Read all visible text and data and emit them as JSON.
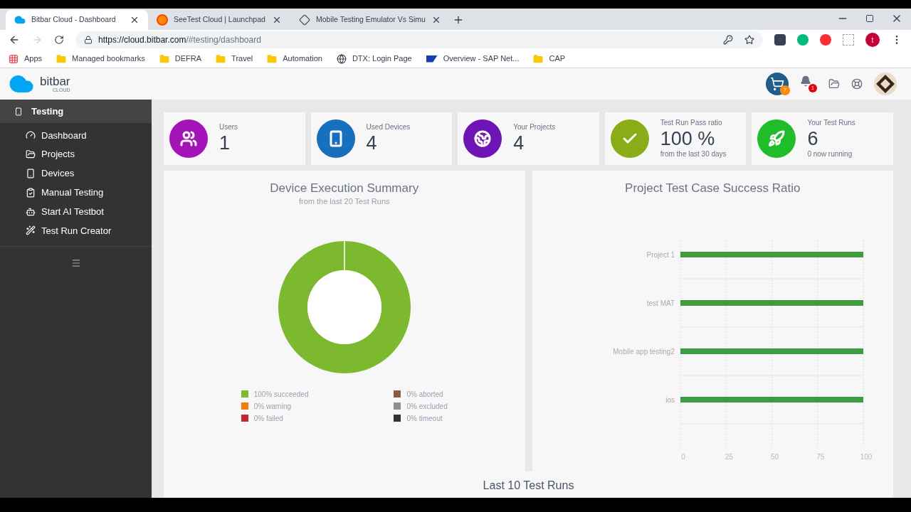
{
  "browser": {
    "tabs": [
      {
        "title": "Bitbar Cloud - Dashboard",
        "kind": "cloud",
        "selected": true
      },
      {
        "title": "SeeTest Cloud | Launchpad",
        "kind": "seetest",
        "selected": false
      },
      {
        "title": "Mobile Testing Emulator Vs Simu",
        "kind": "diamond",
        "selected": false
      }
    ],
    "url_host": "https://cloud.bitbar.com",
    "url_path": "/#testing/dashboard",
    "profile_initial": "t",
    "bookmarks": [
      {
        "label": "Apps",
        "kind": "apps"
      },
      {
        "label": "Managed bookmarks",
        "kind": "folder"
      },
      {
        "label": "DEFRA",
        "kind": "folder"
      },
      {
        "label": "Travel",
        "kind": "folder"
      },
      {
        "label": "Automation",
        "kind": "folder"
      },
      {
        "label": "DTX: Login Page",
        "kind": "globe"
      },
      {
        "label": "Overview - SAP Net...",
        "kind": "sap"
      },
      {
        "label": "CAP",
        "kind": "folder"
      }
    ]
  },
  "header": {
    "logo": "bitbar",
    "logo_sub": "CLOUD",
    "cart_badge": "7",
    "bell_badge": "1"
  },
  "sidebar": {
    "section": "Testing",
    "items": [
      {
        "label": "Dashboard",
        "kind": "gauge"
      },
      {
        "label": "Projects",
        "kind": "folder"
      },
      {
        "label": "Devices",
        "kind": "phone"
      },
      {
        "label": "Manual Testing",
        "kind": "manual"
      },
      {
        "label": "Start AI Testbot",
        "kind": "bot"
      },
      {
        "label": "Test Run Creator",
        "kind": "wand"
      }
    ]
  },
  "stats": [
    {
      "label": "Users",
      "value": "1",
      "kind": "users",
      "color": "#a413b8"
    },
    {
      "label": "Used Devices",
      "value": "4",
      "kind": "phone",
      "color": "#1670be"
    },
    {
      "label": "Your Projects",
      "value": "4",
      "kind": "globe",
      "color": "#6f14b6"
    },
    {
      "label": "Test Run Pass ratio",
      "value": "100 %",
      "note": "from the last 30 days",
      "kind": "check",
      "color": "#8aac17"
    },
    {
      "label": "Your Test Runs",
      "value": "6",
      "note": "0 now running",
      "kind": "rocket",
      "color": "#1fbd2a"
    }
  ],
  "execution_summary": {
    "title": "Device Execution Summary",
    "subtitle": "from the last 20 Test Runs",
    "legend": [
      {
        "label": "100% succeeded",
        "color": "#7cb92f"
      },
      {
        "label": "0% warning",
        "color": "#f07d0c"
      },
      {
        "label": "0% failed",
        "color": "#c4272d"
      },
      {
        "label": "0% aborted",
        "color": "#8d5a42"
      },
      {
        "label": "0% excluded",
        "color": "#8e8e93"
      },
      {
        "label": "0% timeout",
        "color": "#333333"
      }
    ],
    "chart_data": {
      "type": "donut",
      "values": [
        100,
        0,
        0,
        0,
        0,
        0
      ]
    }
  },
  "success_ratio": {
    "title": "Project Test Case Success Ratio",
    "chart_data": {
      "type": "bar",
      "orientation": "horizontal",
      "categories": [
        "Project 1",
        "test MAT",
        "Mobile app testing2",
        "ios"
      ],
      "series": [
        {
          "color": "#3f9b3f",
          "values": [
            100,
            100,
            100,
            100
          ]
        }
      ],
      "xlim": [
        0,
        100
      ],
      "xticks": [
        0,
        25,
        50,
        75,
        100
      ],
      "grid": true
    }
  },
  "last_runs": {
    "title": "Last 10 Test Runs"
  }
}
